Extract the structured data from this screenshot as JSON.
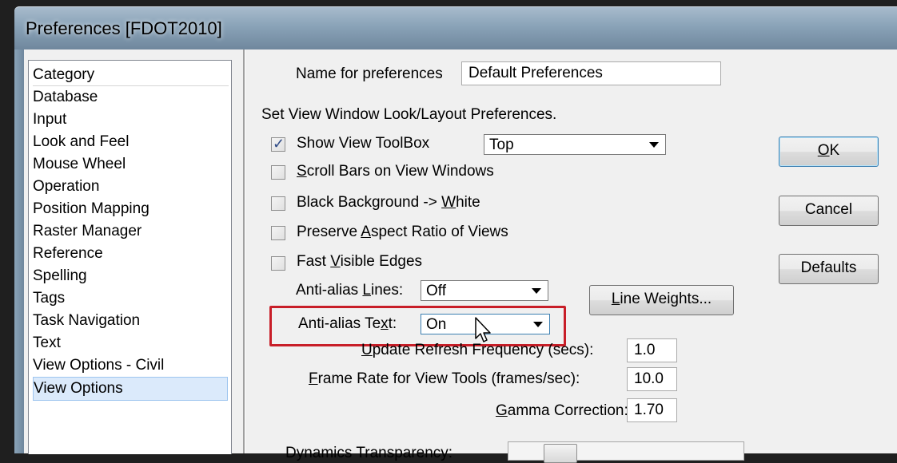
{
  "window": {
    "title": "Preferences [FDOT2010]"
  },
  "category_list": {
    "header": "Category",
    "items": [
      "Database",
      "Input",
      "Look and Feel",
      "Mouse Wheel",
      "Operation",
      "Position Mapping",
      "Raster Manager",
      "Reference",
      "Spelling",
      "Tags",
      "Task Navigation",
      "Text",
      "View Options - Civil",
      "View Options"
    ],
    "selected": "View Options"
  },
  "name_for_preferences": {
    "label": "Name for preferences",
    "value": "Default Preferences"
  },
  "section_title": "Set View Window Look/Layout Preferences.",
  "show_view_toolbox": {
    "label": "Show View ToolBox",
    "checked": true,
    "position_value": "Top"
  },
  "scroll_bars": {
    "label_u": "S",
    "label_rest": "croll Bars on View Windows",
    "checked": false
  },
  "black_background": {
    "label_pre": "Black Background -> ",
    "label_u": "W",
    "label_rest": "hite",
    "checked": false
  },
  "preserve_aspect": {
    "label_pre": "Preserve ",
    "label_u": "A",
    "label_rest": "spect Ratio of Views",
    "checked": false
  },
  "fast_visible_edges": {
    "label_pre": "Fast ",
    "label_u": "V",
    "label_rest": "isible Edges",
    "checked": false
  },
  "anti_alias_lines": {
    "label_pre": "Anti-alias ",
    "label_u": "L",
    "label_rest": "ines:",
    "value": "Off"
  },
  "anti_alias_text": {
    "label_pre": "Anti-alias Te",
    "label_u": "x",
    "label_rest": "t:",
    "value": "On"
  },
  "update_refresh": {
    "label_u": "U",
    "label_rest": "pdate Refresh Frequency (secs):",
    "value": "1.0"
  },
  "frame_rate": {
    "label_u": "F",
    "label_rest": "rame Rate for View Tools (frames/sec):",
    "value": "10.0"
  },
  "gamma_correction": {
    "label_u": "G",
    "label_rest": "amma Correction:",
    "value": "1.70"
  },
  "dynamics_transparency": {
    "label": "Dynamics Transparency:"
  },
  "buttons": {
    "ok_u": "O",
    "ok_rest": "K",
    "cancel": "Cancel",
    "defaults": "Defaults",
    "line_weights_u": "L",
    "line_weights_rest": "ine Weights..."
  },
  "colors": {
    "highlight": "#c81e28",
    "selection": "#dbeafb",
    "check": "#2f4b87"
  }
}
